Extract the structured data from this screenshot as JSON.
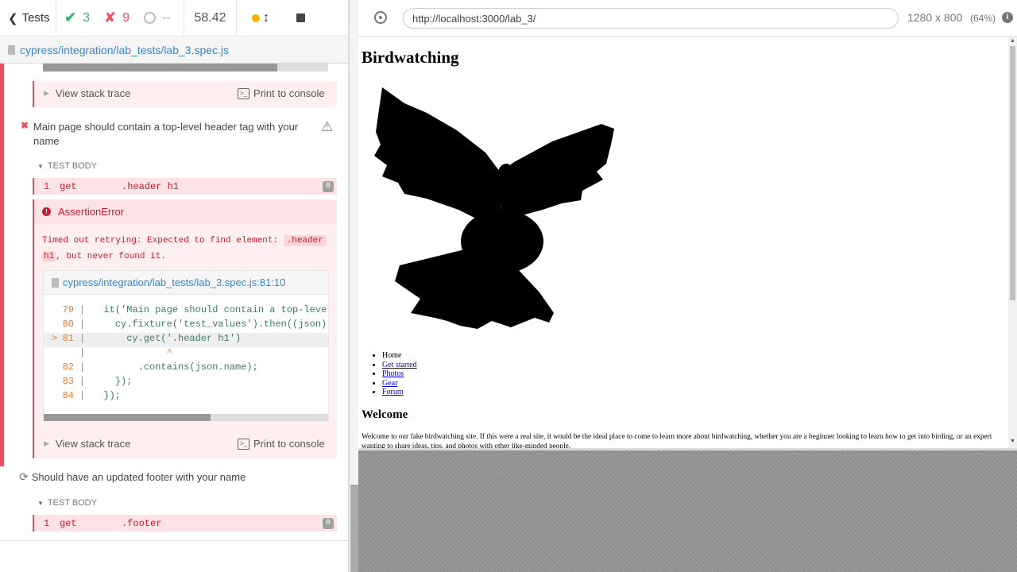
{
  "header": {
    "tests_label": "Tests",
    "passed": "3",
    "failed": "9",
    "pending": "--",
    "duration": "58.42"
  },
  "spec": {
    "path": "cypress/integration/lab_tests/lab_3.spec.js"
  },
  "runner": {
    "view_stack_trace": "View stack trace",
    "print_to_console": "Print to console",
    "test1": {
      "title": "Main page should contain a top-level header tag with your name",
      "body_label": "TEST BODY",
      "cmd_num": "1",
      "cmd_name": "get",
      "cmd_arg": ".header h1",
      "cmd_badge": "0",
      "error_title": "AssertionError",
      "error_msg_pre": "Timed out retrying: Expected to find element: ",
      "error_code": ".header",
      "error_code2": "h1",
      "error_msg_post": ", but never found it.",
      "file_link": "cypress/integration/lab_tests/lab_3.spec.js:81:10",
      "code": [
        {
          "num": "79",
          "text": "  it('Main page should contain a top-level"
        },
        {
          "num": "80",
          "text": "    cy.fixture('test_values').then((json) "
        },
        {
          "num": "81",
          "text": "      cy.get('.header h1')",
          "marker": ">"
        },
        {
          "num": "",
          "text": "             ^"
        },
        {
          "num": "82",
          "text": "        .contains(json.name);"
        },
        {
          "num": "83",
          "text": "    });"
        },
        {
          "num": "84",
          "text": "  });"
        }
      ]
    },
    "test2": {
      "title": "Should have an updated footer with your name",
      "body_label": "TEST BODY",
      "cmd_num": "1",
      "cmd_name": "get",
      "cmd_arg": ".footer",
      "cmd_badge": "0"
    }
  },
  "browser": {
    "url": "http://localhost:3000/lab_3/",
    "viewport": "1280 x 800",
    "scale": "(64%)"
  },
  "page": {
    "title": "Birdwatching",
    "nav": [
      "Home",
      "Get started",
      "Photos",
      "Gear",
      "Forum"
    ],
    "welcome_heading": "Welcome",
    "welcome_text": "Welcome to our fake birdwatching site. If this were a real site, it would be the ideal place to come to learn more about birdwatching, whether you are a beginner looking to learn how to get into birding, or an expert wanting to share ideas, tips, and photos with other like-minded people."
  },
  "colors": {
    "fail": "#e94f5f",
    "pass": "#3cb371",
    "link": "#3386d4"
  }
}
